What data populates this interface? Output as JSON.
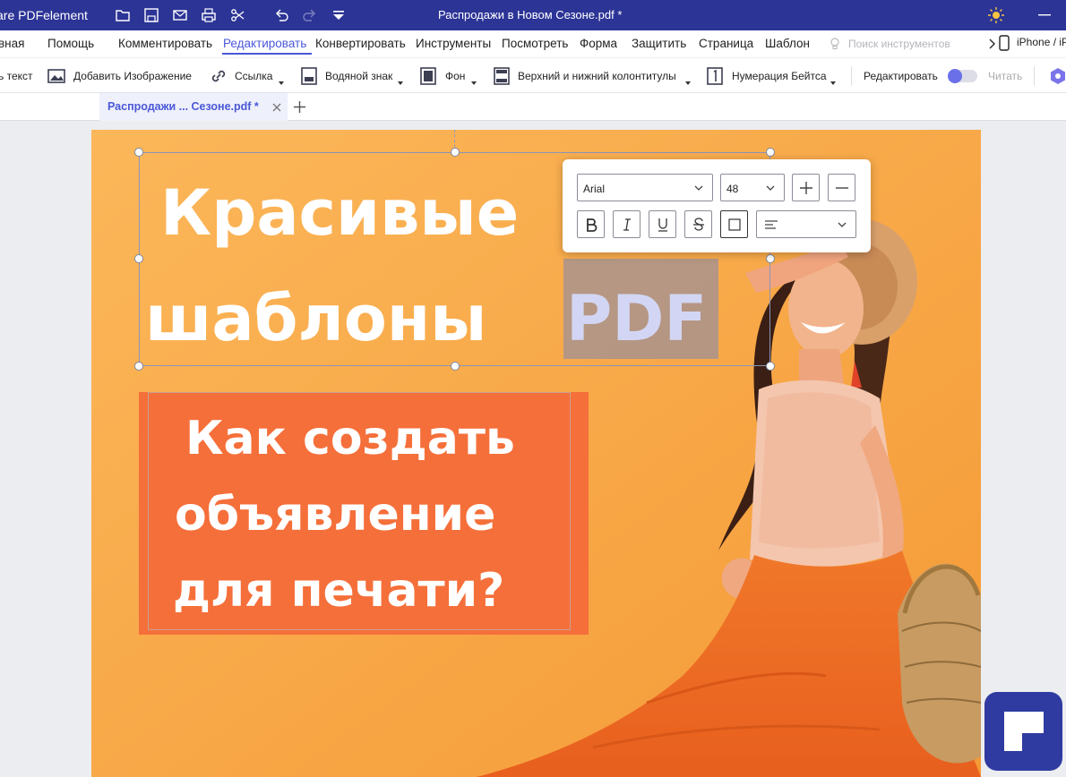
{
  "app": {
    "title": "are PDFelement",
    "document_title": "Распродажи в Новом Сезоне.pdf *"
  },
  "menu": [
    "вная",
    "Помощь",
    "Комментировать",
    "Редактировать",
    "Конвертировать",
    "Инструменты",
    "Посмотреть",
    "Форма",
    "Защитить",
    "Страница",
    "Шаблон"
  ],
  "menu_active": "Редактировать",
  "search": {
    "placeholder": "Поиск инструментов"
  },
  "device": "iPhone / iP",
  "toolbar": {
    "add_text": "ь текст",
    "add_image": "Добавить Изображение",
    "link": "Ссылка",
    "watermark": "Водяной знак",
    "background": "Фон",
    "header_footer": "Верхний и нижний колонтитулы",
    "bates": "Нумерация Бейтса",
    "edit": "Редактировать",
    "read": "Читать"
  },
  "tab": {
    "label": "Распродажи ... Сезоне.pdf *"
  },
  "page": {
    "heading_line1": "Красивые",
    "heading_line2": "шаблоны",
    "heading_pdf": "PDF",
    "box_line1": "Как создать",
    "box_line2": "объявление",
    "box_line3": "для печати?"
  },
  "format": {
    "font": "Arial",
    "size": "48"
  },
  "colors": {
    "titlebar": "#2c3496",
    "accent": "#4a58d8",
    "page_bg": "#f7a24a",
    "box_bg": "#f56f3a"
  }
}
